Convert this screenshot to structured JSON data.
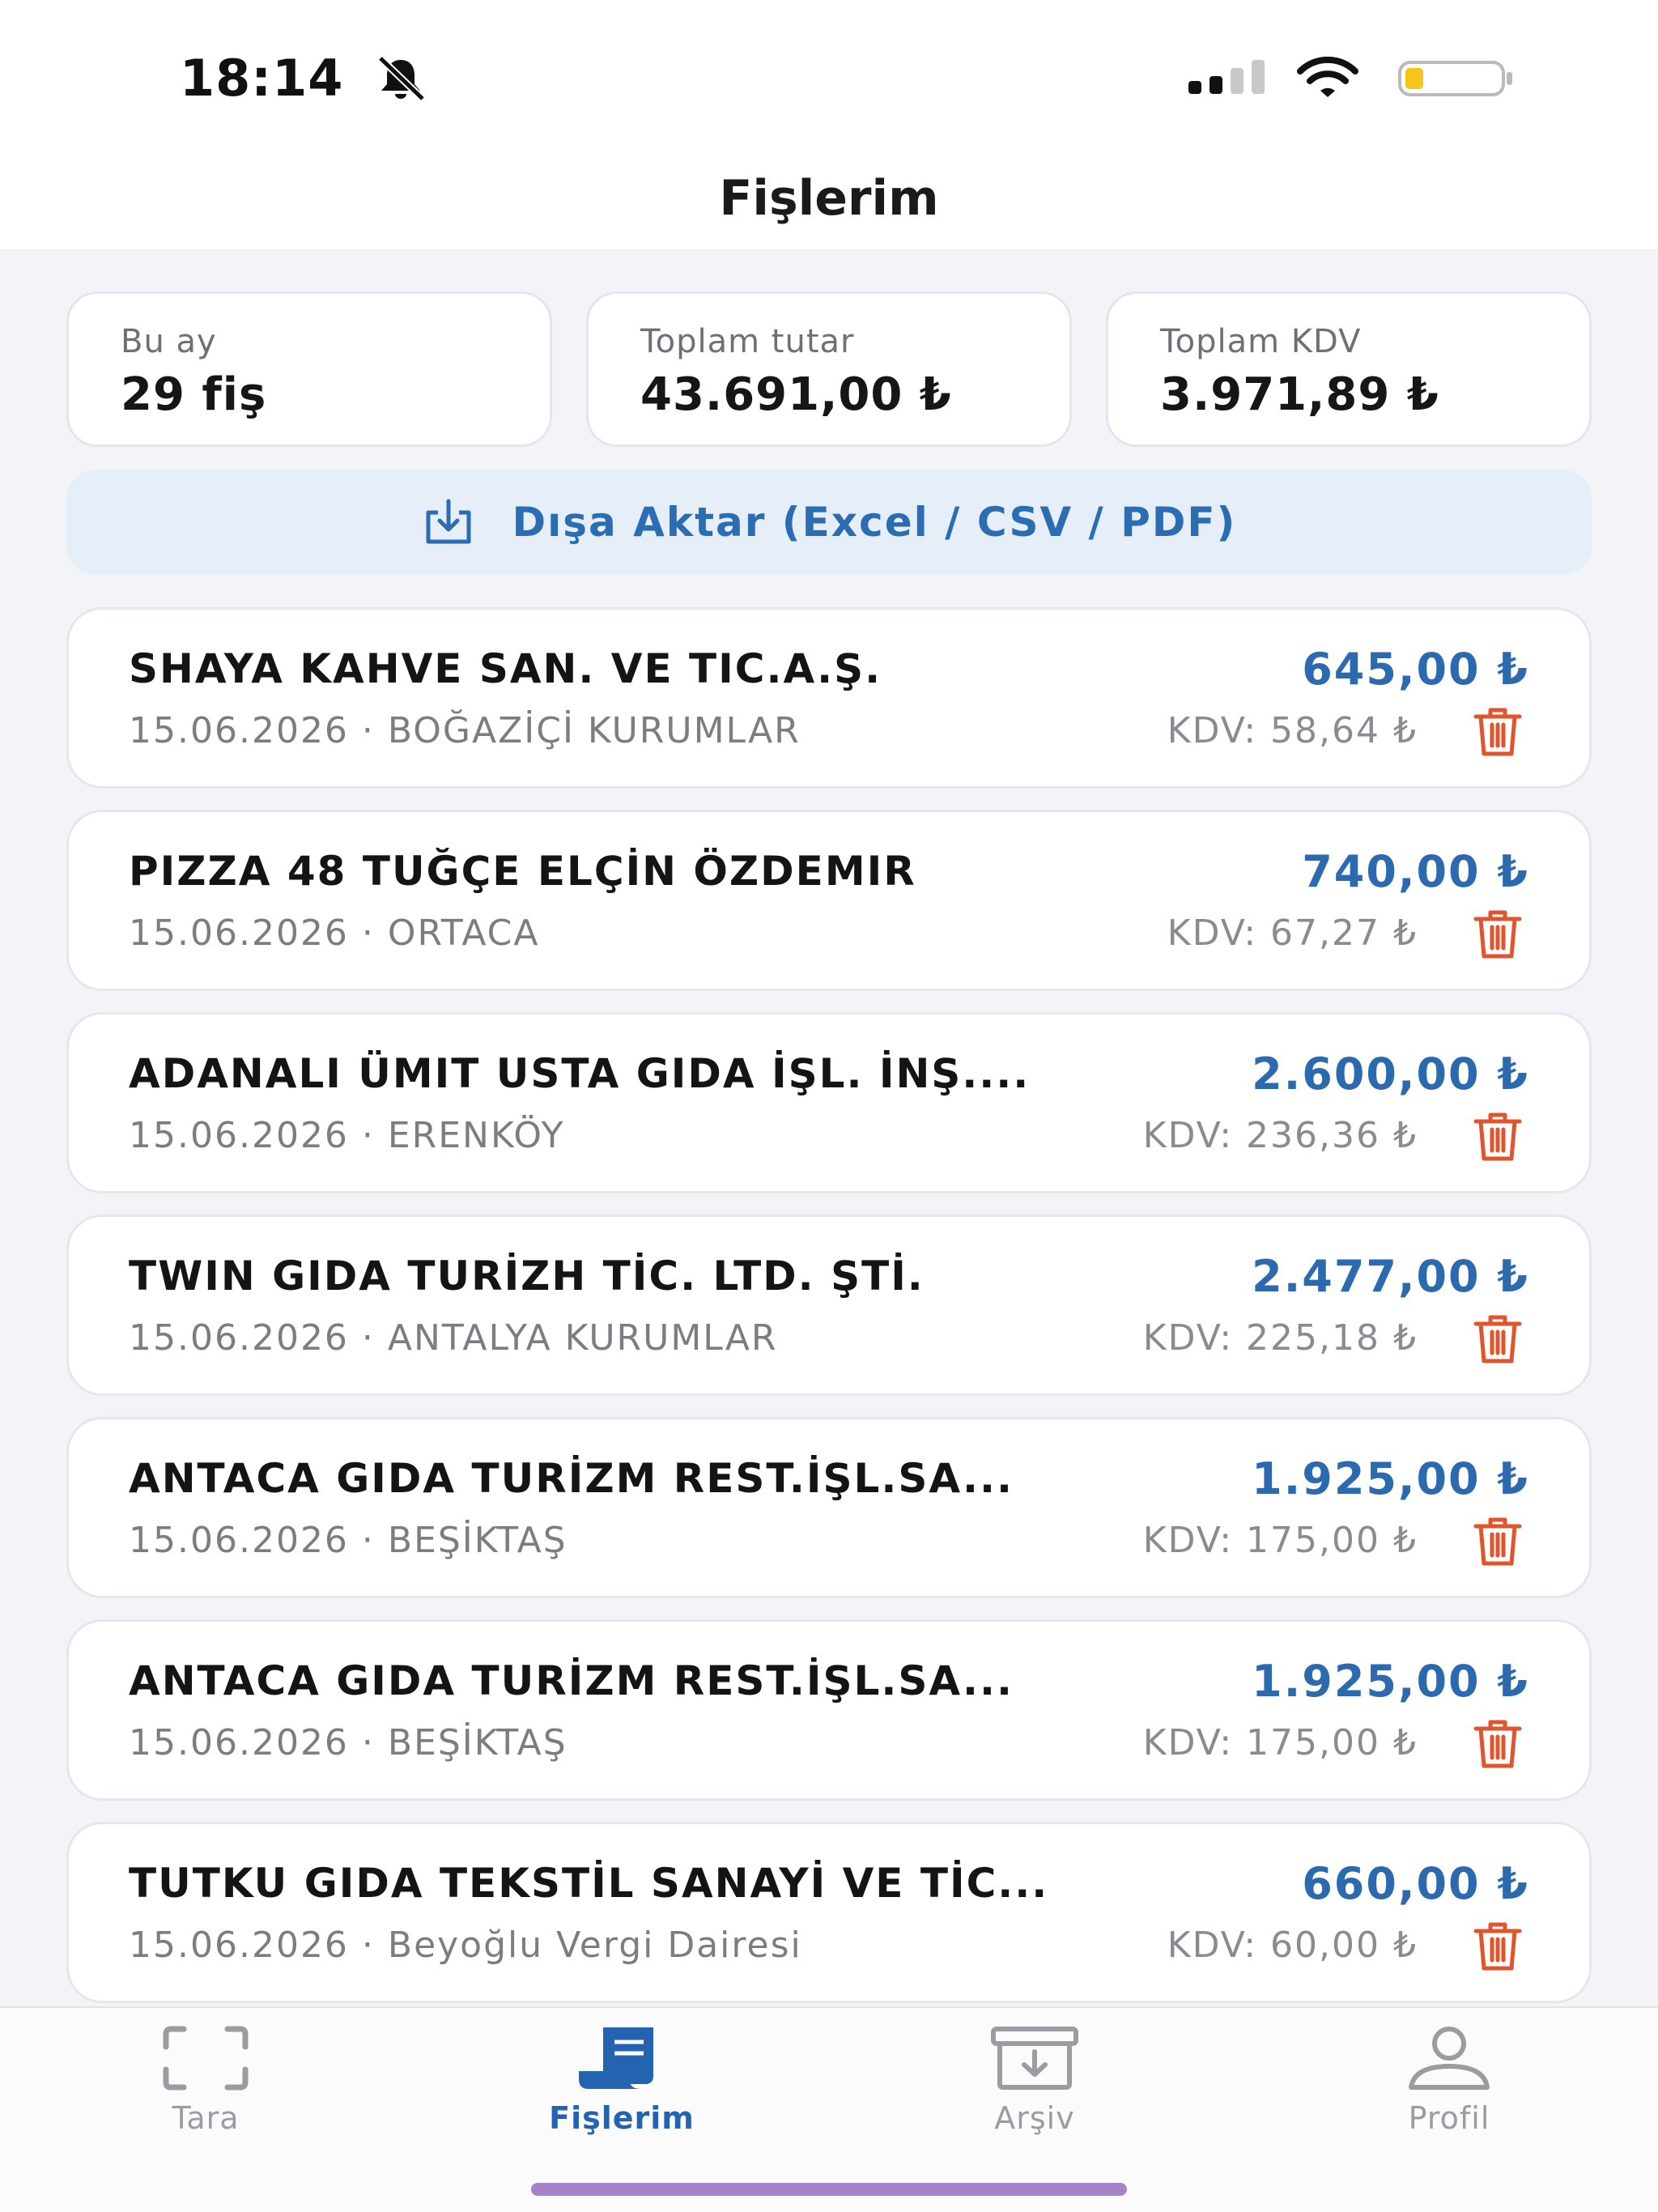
{
  "status_bar": {
    "time": "18:14"
  },
  "header": {
    "title": "Fişlerim"
  },
  "stats": [
    {
      "label": "Bu ay",
      "value": "29 fiş"
    },
    {
      "label": "Toplam tutar",
      "value": "43.691,00 ₺"
    },
    {
      "label": "Toplam KDV",
      "value": "3.971,89 ₺"
    }
  ],
  "export": {
    "label": "Dışa Aktar (Excel / CSV / PDF)"
  },
  "receipts": [
    {
      "name": "SHAYA KAHVE SAN. VE TIC.A.Ş.",
      "date": "15.06.2026",
      "office": "BOĞAZİÇİ KURUMLAR",
      "meta": "15.06.2026 · BOĞAZİÇİ KURUMLAR",
      "amount": "645,00 ₺",
      "kdv": "KDV: 58,64 ₺"
    },
    {
      "name": "PIZZA 48 TUĞÇE ELÇİN ÖZDEMIR",
      "date": "15.06.2026",
      "office": "ORTACA",
      "meta": "15.06.2026 · ORTACA",
      "amount": "740,00 ₺",
      "kdv": "KDV: 67,27 ₺"
    },
    {
      "name": "ADANALI ÜMIT USTA GIDA İŞL. İNŞ....",
      "date": "15.06.2026",
      "office": "ERENKÖY",
      "meta": "15.06.2026 · ERENKÖY",
      "amount": "2.600,00 ₺",
      "kdv": "KDV: 236,36 ₺"
    },
    {
      "name": "TWIN GIDA TURİZH TİC. LTD. ŞTİ.",
      "date": "15.06.2026",
      "office": "ANTALYA KURUMLAR",
      "meta": "15.06.2026 · ANTALYA KURUMLAR",
      "amount": "2.477,00 ₺",
      "kdv": "KDV: 225,18 ₺"
    },
    {
      "name": "ANTACA GIDA TURİZM REST.İŞL.SA...",
      "date": "15.06.2026",
      "office": "BEŞİKTAŞ",
      "meta": "15.06.2026 · BEŞİKTAŞ",
      "amount": "1.925,00 ₺",
      "kdv": "KDV: 175,00 ₺"
    },
    {
      "name": "ANTACA GIDA TURİZM REST.İŞL.SA...",
      "date": "15.06.2026",
      "office": "BEŞİKTAŞ",
      "meta": "15.06.2026 · BEŞİKTAŞ",
      "amount": "1.925,00 ₺",
      "kdv": "KDV: 175,00 ₺"
    },
    {
      "name": "TUTKU GIDA TEKSTİL SANAYİ VE TİC...",
      "date": "15.06.2026",
      "office": "Beyoğlu Vergi Dairesi",
      "meta": "15.06.2026 · Beyoğlu Vergi Dairesi",
      "amount": "660,00 ₺",
      "kdv": "KDV: 60,00 ₺"
    }
  ],
  "tabs": [
    {
      "label": "Tara",
      "icon": "scan-icon",
      "active": false
    },
    {
      "label": "Fişlerim",
      "icon": "receipts-icon",
      "active": true
    },
    {
      "label": "Arşiv",
      "icon": "archive-icon",
      "active": false
    },
    {
      "label": "Profil",
      "icon": "profile-icon",
      "active": false
    }
  ],
  "colors": {
    "accent": "#2c6ab0",
    "delete": "#e0552c",
    "background": "#f2f4f8",
    "export_bg": "#e6eef7"
  }
}
